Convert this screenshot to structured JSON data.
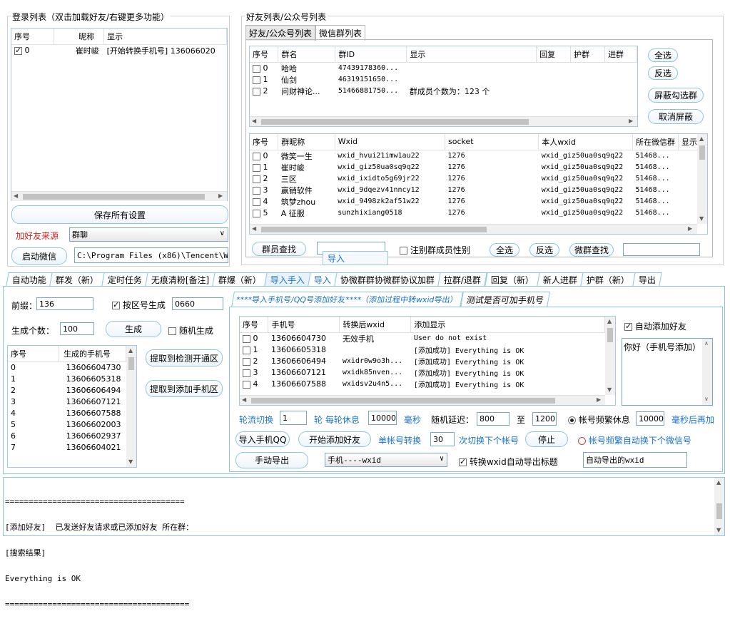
{
  "login_group": {
    "title": "登录列表（双击加载好友/右键更多功能）",
    "columns": [
      "序号",
      "昵称",
      "显示"
    ],
    "rows": [
      [
        "0",
        "崔时峻",
        "[开始转换手机号] 136066020"
      ]
    ],
    "save_button": "保存所有设置",
    "friend_source_label": "加好友来源",
    "friend_source_value": "群聊",
    "start_wechat_button": "启动微信",
    "wechat_path": "C:\\Program Files (x86)\\Tencent\\WeChe"
  },
  "friend_group": {
    "title": "好友列表/公众号列表",
    "tabs": [
      "好友/公众号列表",
      "微信群列表"
    ],
    "group_columns": [
      "序号",
      "群名",
      "群ID",
      "显示",
      "回复",
      "护群",
      "进群"
    ],
    "group_rows": [
      [
        "0",
        "哈哈",
        "47439178360...",
        ""
      ],
      [
        "1",
        "仙剑",
        "46319151650...",
        ""
      ],
      [
        "2",
        "问财神论...",
        "51466881750...",
        "群成员个数为：123 个"
      ]
    ],
    "side_buttons": [
      "全选",
      "反选",
      "屏蔽勾选群",
      "取消屏蔽"
    ],
    "member_columns": [
      "序号",
      "群昵称",
      "Wxid",
      "socket",
      "本人wxid",
      "所在微信群",
      "显示"
    ],
    "member_rows": [
      [
        "0",
        "微笑一生",
        "wxid_hvui21imw1au22",
        "1276",
        "wxid_giz50ua0sq9q22",
        "51468..."
      ],
      [
        "1",
        "崔时峻",
        "wxid_giz50ua0sq9q22",
        "1276",
        "wxid_giz50ua0sq9q22",
        "51468..."
      ],
      [
        "2",
        "三区",
        "wxid_ixidto5g69jr22",
        "1276",
        "wxid_giz50ua0sq9q22",
        "51468..."
      ],
      [
        "3",
        "赢销软件",
        "wxid_9dqezv41nncy12",
        "1276",
        "wxid_giz50ua0sq9q22",
        "51468..."
      ],
      [
        "4",
        "筑梦zhou",
        "wxid_9498zk2af51w22",
        "1276",
        "wxid_giz50ua0sq9q22",
        "51468..."
      ],
      [
        "5",
        "A 征服",
        "sunzhixiang0518",
        "1276",
        "wxid_giz50ua0sq9q22",
        "51468..."
      ]
    ],
    "member_search_button": "群员查找",
    "import_tooltip": "导入",
    "gender_label": "注别群成员性别",
    "bottom_select_all": "全选",
    "bottom_invert": "反选",
    "wechat_group_search": "微群查找"
  },
  "main_tabs": [
    "自动功能",
    "群发（新）",
    "定时任务",
    "无痕清粉[备注]",
    "群爆（新）",
    "导入手入",
    "导入",
    "协微群群协微群协议加群",
    "拉群/退群",
    "回复（新）",
    "新人进群",
    "护群（新）",
    "导出"
  ],
  "generator": {
    "prefix_label": "前缀：",
    "prefix_value": "136",
    "by_area_label": "按区号生成",
    "area_value": "0660",
    "count_label": "生成个数：",
    "count_value": "100",
    "generate_button": "生成",
    "random_label": "随机生成",
    "columns": [
      "序号",
      "生成的手机号"
    ],
    "rows": [
      [
        "0",
        "13606604730"
      ],
      [
        "1",
        "13606605318"
      ],
      [
        "2",
        "13606606494"
      ],
      [
        "3",
        "13606607121"
      ],
      [
        "4",
        "13606607588"
      ],
      [
        "5",
        "13606602003"
      ],
      [
        "6",
        "13606602937"
      ],
      [
        "7",
        "13606604021"
      ]
    ],
    "extract_detect_button": "提取到检测开通区",
    "extract_add_button": "提取到添加手机区"
  },
  "import_panel": {
    "tabs": [
      "****导入手机号/QQ号添加好友****（添加过程中转wxid导出）",
      "测试是否可加手机号"
    ],
    "columns": [
      "序号",
      "手机号",
      "转换后wxid",
      "添加显示"
    ],
    "rows": [
      [
        "0",
        "13606604730",
        "无效手机",
        "User do not exist"
      ],
      [
        "1",
        "13606605318",
        "",
        "[添加成功] Everything is OK"
      ],
      [
        "2",
        "13606606494",
        "wxidr0w9o3h...",
        "[添加成功] Everything is OK"
      ],
      [
        "3",
        "13606607121",
        "wxidk85nven...",
        "[添加成功] Everything is OK"
      ],
      [
        "4",
        "13606607588",
        "wxidsv2u4n5...",
        "[添加成功] Everything is OK"
      ]
    ],
    "auto_add_label": "自动添加好友",
    "greeting": "你好（手机号添加）",
    "rotate_label": "轮流切换",
    "rotate_value": "1",
    "round_rest_label": "轮 每轮休息",
    "round_rest_value": "10000",
    "ms_label": "毫秒",
    "random_delay_label": "随机延迟：",
    "delay_min": "800",
    "to_label": "至",
    "delay_max": "1200",
    "freq_rest_label": "帐号频繁休息",
    "freq_rest_value": "10000",
    "ms_then_add": "毫秒后再加",
    "import_phone_button": "导入手机QQ",
    "start_add_button": "开始添加好友",
    "single_switch_label": "单帐号转换",
    "single_switch_value": "30",
    "next_account_label": "次切换下个帐号",
    "stop_button": "停止",
    "auto_switch_label": "帐号频繁自动换下个微信号",
    "manual_export_button": "手动导出",
    "export_format": "手机----wxid",
    "auto_export_title_label": "转换wxid自动导出标题",
    "auto_export_value": "自动导出的wxid"
  },
  "log": {
    "lines": [
      "======================================",
      "[添加好友]  已发送好友请求或已添加好友 所在群：",
      "[搜索结果]",
      "Everything is OK",
      "======================================="
    ]
  }
}
